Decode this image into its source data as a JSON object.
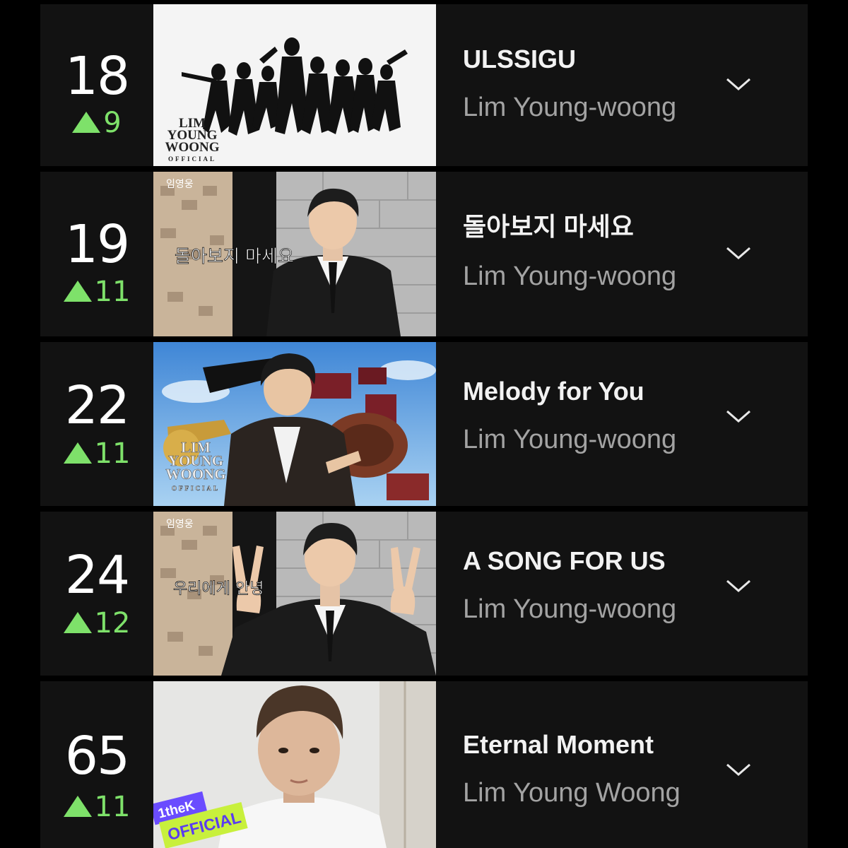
{
  "chart_list": {
    "rows": [
      {
        "rank": "18",
        "change": "9",
        "title": "ULSSIGU",
        "artist": "Lim Young-woong",
        "thumbnail_logo": [
          "LIM",
          "YOUNG",
          "WOONG",
          "OFFICIAL"
        ]
      },
      {
        "rank": "19",
        "change": "11",
        "title": "돌아보지 마세요",
        "artist": "Lim Young-woong",
        "thumbnail_caption": "돌아보지 마세요",
        "thumbnail_corner": "임영웅"
      },
      {
        "rank": "22",
        "change": "11",
        "title": "Melody for You",
        "artist": "Lim Young-woong",
        "thumbnail_logo": [
          "LIM",
          "YOUNG",
          "WOONG",
          "OFFICIAL"
        ]
      },
      {
        "rank": "24",
        "change": "12",
        "title": "A SONG FOR US",
        "artist": "Lim Young-woong",
        "thumbnail_caption": "우리에게 안녕",
        "thumbnail_corner": "임영웅"
      },
      {
        "rank": "65",
        "change": "11",
        "title": "Eternal Moment",
        "artist": "Lim Young Woong",
        "thumbnail_badge_top": "1theK",
        "thumbnail_badge_bottom": "OFFICIAL"
      }
    ]
  },
  "icons": {
    "rank_up": "triangle-up-icon",
    "expand": "chevron-down-icon"
  },
  "colors": {
    "background": "#000000",
    "row_background": "#121212",
    "rank_up_green": "#7ee16a",
    "title_text": "#f2f2f2",
    "artist_text": "#a3a3a3",
    "badge_purple": "#6a4cff",
    "badge_green": "#c8f03c"
  }
}
